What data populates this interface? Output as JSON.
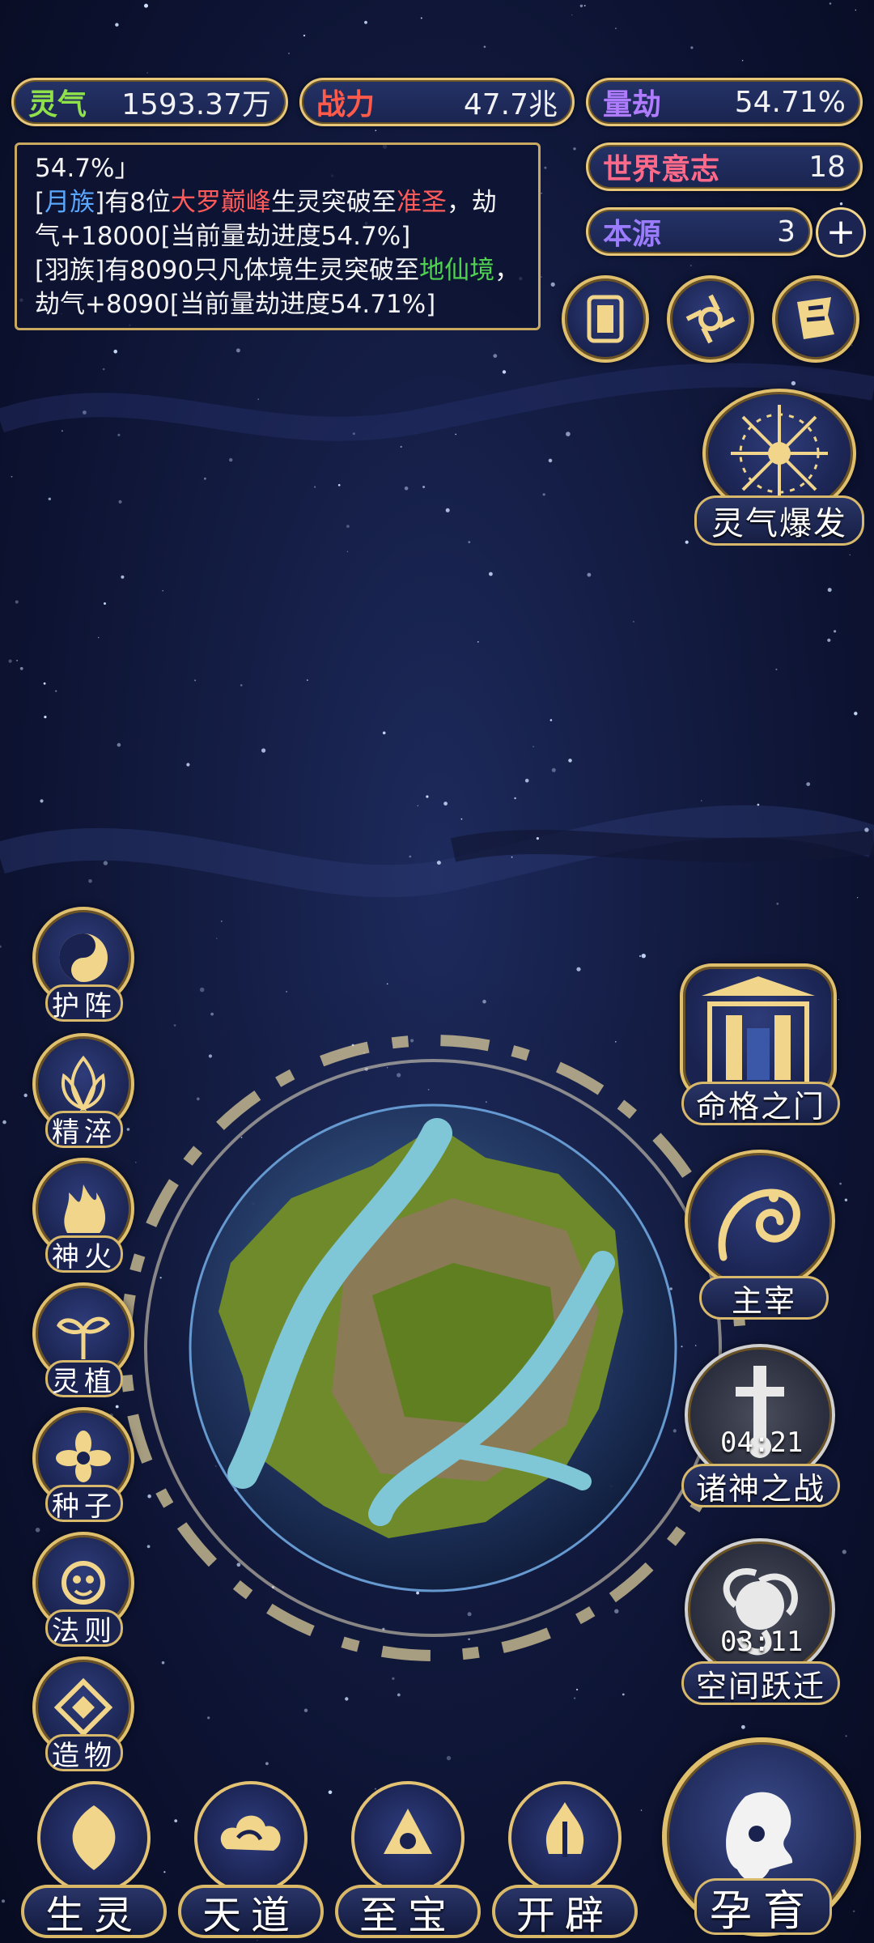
{
  "stats": {
    "lingqi": {
      "label": "灵气",
      "value": "1593.37万",
      "label_color": "#8fe04a"
    },
    "zhanli": {
      "label": "战力",
      "value": "47.7兆",
      "label_color": "#ff5a4a"
    },
    "liangjie": {
      "label": "量劫",
      "value": "54.71%",
      "label_color": "#b07cff"
    },
    "shijie": {
      "label": "世界意志",
      "value": "18",
      "label_color": "#ff6a8a"
    },
    "benyuan": {
      "label": "本源",
      "value": "3",
      "label_color": "#9b7cff"
    },
    "add_symbol": "+"
  },
  "log": {
    "line0": "54.7%」",
    "msg1": {
      "prefix": "[",
      "tribe": "月族",
      "mid": "]有8位",
      "realm": "大罗巅峰",
      "mid2": "生灵突破至",
      "target": "准圣",
      "tail": "，劫气+18000[当前量劫进度54.7%]"
    },
    "msg2": {
      "prefix": "[羽族]有8090只凡体境生灵突破至",
      "target": "地仙境",
      "tail": "，劫气+8090[当前量劫进度54.71%]"
    }
  },
  "top_icons": [
    "card-icon",
    "vortex-icon",
    "flag-icon"
  ],
  "burst": {
    "label": "灵气爆发"
  },
  "left_menu": [
    {
      "label": "护阵",
      "icon": "yin-yang-icon"
    },
    {
      "label": "精淬",
      "icon": "lotus-flame-icon"
    },
    {
      "label": "神火",
      "icon": "fire-icon"
    },
    {
      "label": "灵植",
      "icon": "plant-icon"
    },
    {
      "label": "种子",
      "icon": "seed-flower-icon"
    },
    {
      "label": "法则",
      "icon": "law-icon"
    },
    {
      "label": "造物",
      "icon": "creation-icon"
    }
  ],
  "right_menu": [
    {
      "label": "命格之门",
      "icon": "gate-icon"
    },
    {
      "label": "主宰",
      "icon": "dragon-icon"
    },
    {
      "label": "诸神之战",
      "icon": "sword-icon",
      "timer": "04:21"
    },
    {
      "label": "空间跃迁",
      "icon": "portal-icon",
      "timer": "03:11"
    }
  ],
  "bottom_nav": [
    {
      "label": "生灵",
      "icon": "phoenix-icon"
    },
    {
      "label": "天道",
      "icon": "cloud-icon"
    },
    {
      "label": "至宝",
      "icon": "treasure-icon"
    },
    {
      "label": "开辟",
      "icon": "axe-flame-icon"
    }
  ],
  "nurture": {
    "label": "孕育"
  }
}
